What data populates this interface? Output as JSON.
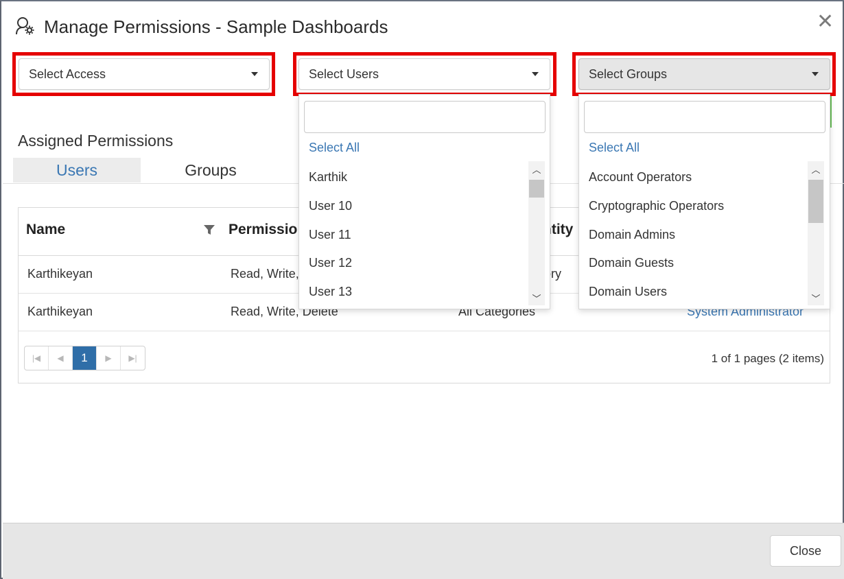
{
  "dialog": {
    "title": "Manage Permissions - Sample Dashboards",
    "title_icon": "user-settings-icon",
    "close_icon": "close-icon",
    "close_label": "✕"
  },
  "filters": {
    "access_label": "Select Access",
    "users_label": "Select Users",
    "groups_label": "Select Groups"
  },
  "users_dropdown": {
    "search_value": "",
    "select_all": "Select All",
    "options": [
      "Karthik",
      "User 10",
      "User 11",
      "User 12",
      "User 13"
    ]
  },
  "groups_dropdown": {
    "search_value": "",
    "select_all": "Select All",
    "options": [
      "Account Operators",
      "Cryptographic Operators",
      "Domain Admins",
      "Domain Guests",
      "Domain Users"
    ]
  },
  "assigned": {
    "title": "Assigned Permissions",
    "tabs": [
      {
        "label": "Users",
        "active": true
      },
      {
        "label": "Groups",
        "active": false
      }
    ]
  },
  "grid": {
    "headers": {
      "name": "Name",
      "permissions": "Permissio",
      "entity": "ntity"
    },
    "rows": [
      {
        "name": "Karthikeyan",
        "permissions": "Read, Write,",
        "entity": "ory",
        "scope": ""
      },
      {
        "name": "Karthikeyan",
        "permissions": "Read, Write, Delete",
        "entity": "All Categories",
        "scope": "System Administrator"
      }
    ],
    "pager": {
      "current_page": "1",
      "info": "1 of 1 pages (2 items)"
    }
  },
  "footer": {
    "close_label": "Close"
  },
  "colors": {
    "highlight": "#e50000",
    "link": "#3a77b3",
    "pager_active": "#2f6ea8"
  }
}
